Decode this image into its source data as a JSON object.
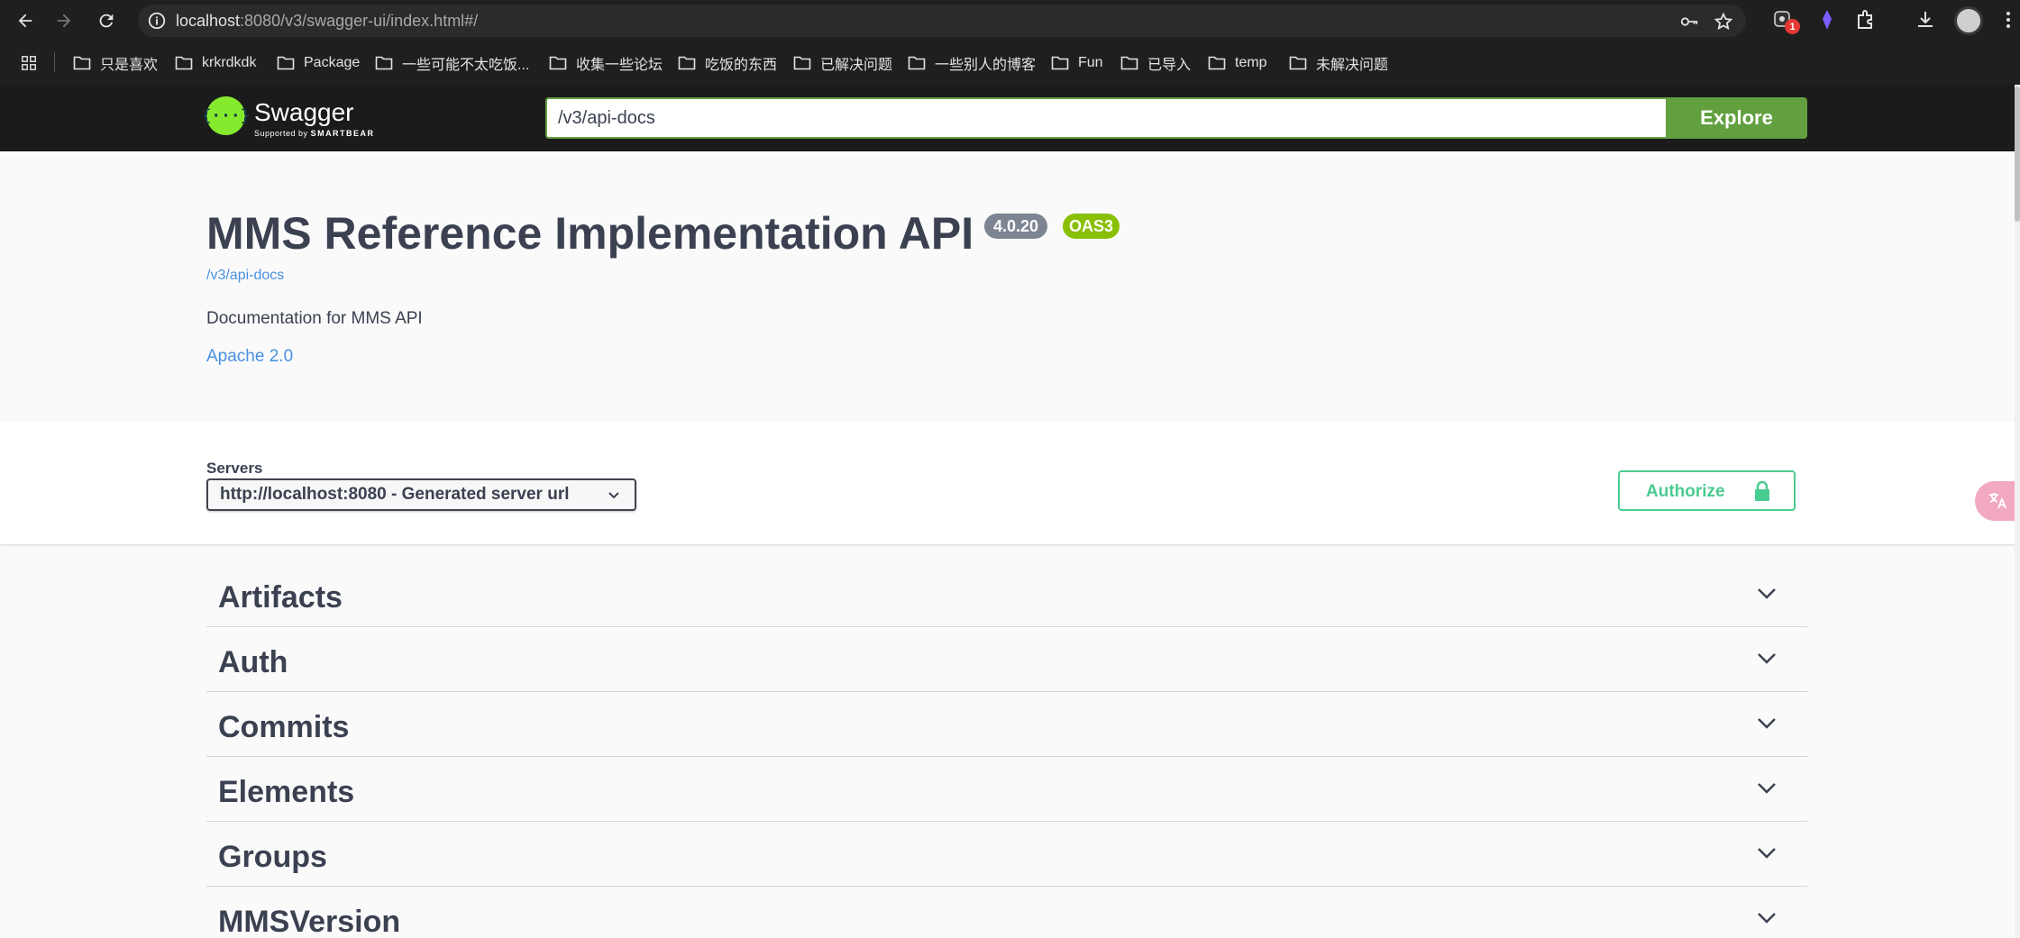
{
  "browser": {
    "url_host": "localhost",
    "url_path": ":8080/v3/swagger-ui/index.html#/",
    "extension_badge": "1"
  },
  "bookmarks": [
    {
      "label": "只是喜欢"
    },
    {
      "label": "krkrdkdk"
    },
    {
      "label": "Package"
    },
    {
      "label": "一些可能不太吃饭..."
    },
    {
      "label": "收集一些论坛"
    },
    {
      "label": "吃饭的东西"
    },
    {
      "label": "已解决问题"
    },
    {
      "label": "一些别人的博客"
    },
    {
      "label": "Fun"
    },
    {
      "label": "已导入"
    },
    {
      "label": "temp"
    },
    {
      "label": "未解决问题"
    }
  ],
  "swagger": {
    "logo_text": "Swagger",
    "logo_supported": "Supported by",
    "logo_brand": "SMARTBEAR",
    "spec_url": "/v3/api-docs",
    "explore_label": "Explore",
    "title": "MMS Reference Implementation API",
    "version": "4.0.20",
    "oas": "OAS3",
    "spec_link": "/v3/api-docs",
    "description": "Documentation for MMS API",
    "license": "Apache 2.0",
    "servers_label": "Servers",
    "server_selected": "http://localhost:8080 - Generated server url",
    "authorize_label": "Authorize",
    "tags": [
      "Artifacts",
      "Auth",
      "Commits",
      "Elements",
      "Groups",
      "MMSVersion"
    ]
  },
  "colors": {
    "accent_green": "#62a03f",
    "authorize_green": "#49cc90",
    "link_blue": "#4990e2",
    "oas_badge": "#89bf04",
    "version_badge": "#7d8492"
  }
}
